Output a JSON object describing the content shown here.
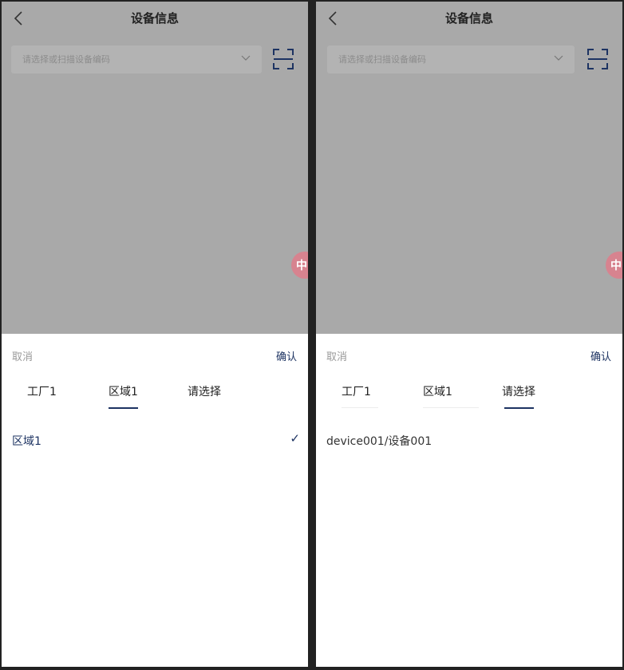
{
  "header": {
    "title": "设备信息"
  },
  "device_select": {
    "placeholder": "请选择或扫描设备编码"
  },
  "float_badge": {
    "label": "中"
  },
  "sheet": {
    "cancel": "取消",
    "confirm": "确认"
  },
  "left": {
    "tabs": [
      "工厂1",
      "区域1",
      "请选择"
    ],
    "active_tab": 1,
    "option": "区域1",
    "check": "✓"
  },
  "right": {
    "tabs": [
      "工厂1",
      "区域1",
      "请选择"
    ],
    "active_tab": 2,
    "option": "device001/设备001"
  },
  "icons": [
    "back-arrow-icon",
    "chevron-down-icon",
    "scan-icon",
    "checkmark-icon"
  ],
  "colors": {
    "accent": "#1d3362",
    "overlay": "#a9a9a9",
    "badge": "#d7838f"
  }
}
